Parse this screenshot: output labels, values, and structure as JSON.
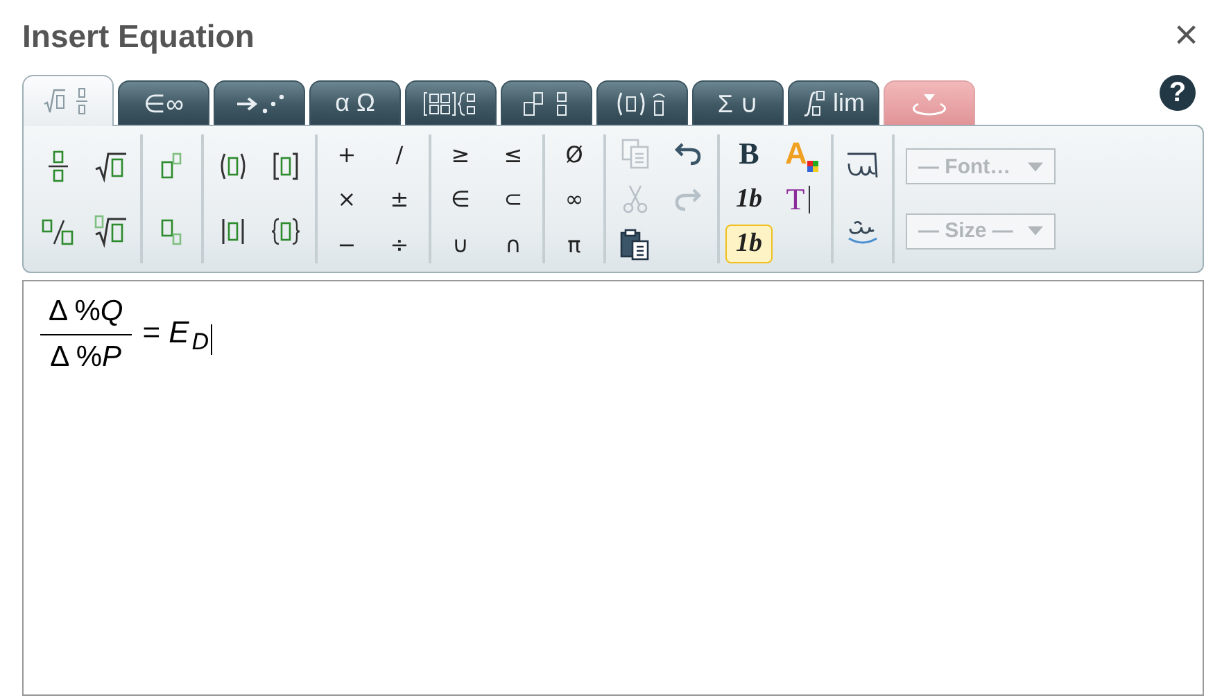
{
  "window": {
    "title": "Insert Equation",
    "close": "×"
  },
  "tabs": [
    {
      "kind": "templates",
      "selected": true
    },
    {
      "kind": "text",
      "label": "∈∞",
      "selected": false
    },
    {
      "kind": "arrows",
      "selected": false
    },
    {
      "kind": "text",
      "label": "α Ω",
      "selected": false
    },
    {
      "kind": "matrix",
      "selected": false
    },
    {
      "kind": "scripts",
      "selected": false
    },
    {
      "kind": "accents",
      "selected": false
    },
    {
      "kind": "text",
      "label": "Σ ∪",
      "selected": false
    },
    {
      "kind": "integral",
      "label": "lim",
      "selected": false
    },
    {
      "kind": "special",
      "selected": false
    }
  ],
  "help": "?",
  "toolbar": {
    "groups": [
      {
        "rows": [
          [
            {
              "kind": "fraction"
            },
            {
              "kind": "radical"
            }
          ],
          [
            {
              "kind": "slashfraction"
            },
            {
              "kind": "nthroot"
            }
          ]
        ]
      },
      {
        "rows": [
          [
            {
              "kind": "superscript"
            }
          ],
          [
            {
              "kind": "subscript"
            }
          ]
        ]
      },
      {
        "rows": [
          [
            {
              "kind": "parentheses"
            },
            {
              "kind": "brackets"
            }
          ],
          [
            {
              "kind": "absolute"
            },
            {
              "kind": "braces"
            }
          ]
        ]
      },
      {
        "rows": [
          [
            {
              "kind": "symbol",
              "label": "+"
            },
            {
              "kind": "symbol",
              "label": "/"
            }
          ],
          [
            {
              "kind": "symbol",
              "label": "×"
            },
            {
              "kind": "symbol",
              "label": "±"
            }
          ],
          [
            {
              "kind": "symbol",
              "label": "−"
            },
            {
              "kind": "symbol",
              "label": "÷"
            }
          ]
        ]
      },
      {
        "rows": [
          [
            {
              "kind": "symbol",
              "label": "≥"
            },
            {
              "kind": "symbol",
              "label": "≤"
            }
          ],
          [
            {
              "kind": "symbol",
              "label": "∈"
            },
            {
              "kind": "symbol",
              "label": "⊂"
            }
          ],
          [
            {
              "kind": "symbol",
              "label": "∪"
            },
            {
              "kind": "symbol",
              "label": "∩"
            }
          ]
        ]
      },
      {
        "rows": [
          [
            {
              "kind": "symbol",
              "label": "Ø"
            }
          ],
          [
            {
              "kind": "symbol",
              "label": "∞"
            }
          ],
          [
            {
              "kind": "symbol",
              "label": "π"
            }
          ]
        ]
      },
      {
        "rows": [
          [
            {
              "kind": "copy",
              "disabled": true
            },
            {
              "kind": "undo",
              "disabled": false
            }
          ],
          [
            {
              "kind": "cut",
              "disabled": true
            },
            {
              "kind": "redo",
              "disabled": true
            }
          ],
          [
            {
              "kind": "paste",
              "disabled": false
            }
          ]
        ]
      },
      {
        "rows": [
          [
            {
              "kind": "bold",
              "label": "B",
              "selected": false
            },
            {
              "kind": "fontcolor",
              "label": "A"
            }
          ],
          [
            {
              "kind": "italic",
              "label": "1b",
              "selected": false
            },
            {
              "kind": "textmode",
              "label": "T"
            }
          ],
          [
            {
              "kind": "italic",
              "label": "1b",
              "selected": true
            }
          ]
        ]
      },
      {
        "rows": [
          [
            {
              "kind": "overline"
            }
          ],
          [
            {
              "kind": "underline"
            }
          ]
        ]
      }
    ],
    "dropdowns": [
      {
        "label": "— Font…",
        "disabled": true
      },
      {
        "label": "— Size —",
        "disabled": true
      }
    ]
  },
  "editor": {
    "numerator": "Δ %*Q*",
    "denominator": "Δ %*P*",
    "relation": "=",
    "variable": "E",
    "subscript": "D"
  }
}
